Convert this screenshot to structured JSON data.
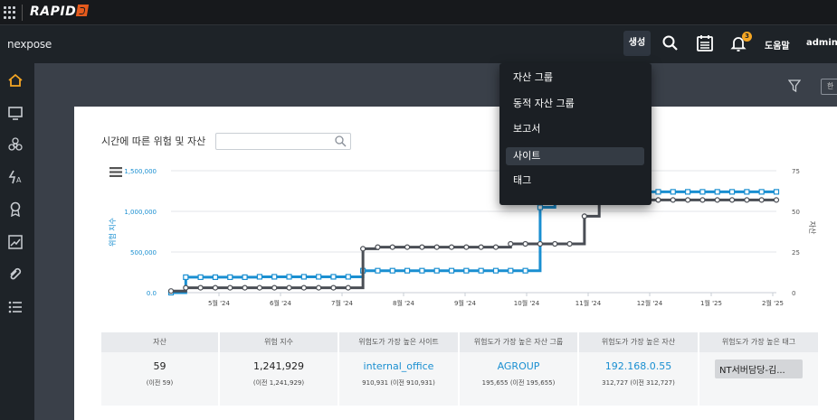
{
  "topbar": {
    "brand": "RAPID"
  },
  "header": {
    "product": "nexpose",
    "create_label": "생성",
    "notification_count": "3",
    "help_label": "도움말",
    "user_label": "admin"
  },
  "toolbar": {
    "box_label": "한"
  },
  "card": {
    "title": "시간에 따른 위험 및 자산",
    "search_placeholder": ""
  },
  "chart_data": {
    "type": "line",
    "x": [
      "5월 '24",
      "6월 '24",
      "7월 '24",
      "8월 '24",
      "9월 '24",
      "10월 '24",
      "11월 '24",
      "12월 '24",
      "1월 '25",
      "2월 '25"
    ],
    "ylabel": "위험 지수",
    "y2label": "자산",
    "y_ticks": [
      "0.0",
      "500,000",
      "1,000,000",
      "1,500,000"
    ],
    "y2_ticks": [
      "0",
      "25",
      "50",
      "75"
    ],
    "ylim": [
      0,
      1500000
    ],
    "y2lim": [
      0,
      75
    ],
    "series": [
      {
        "color": "#1a8fd1",
        "axis": "left",
        "values": [
          0,
          190000,
          190000,
          190000,
          190000,
          190000,
          195000,
          195000,
          195000,
          195000,
          195000,
          195000,
          195000,
          270000,
          270000,
          270000,
          270000,
          270000,
          270000,
          270000,
          270000,
          270000,
          270000,
          270000,
          270000,
          1050000,
          1240000,
          1240000,
          1240000,
          1240000,
          1240000,
          1240000,
          1240000,
          1240000,
          1240000,
          1240000,
          1240000,
          1240000,
          1240000,
          1240000,
          1240000,
          1240000
        ]
      },
      {
        "color": "#4a4e55",
        "axis": "right",
        "values": [
          1,
          3,
          3,
          3,
          3,
          3,
          3,
          3,
          3,
          3,
          3,
          3,
          3,
          27,
          28,
          28,
          28,
          28,
          28,
          28,
          28,
          28,
          28,
          30,
          30,
          30,
          30,
          30,
          47,
          57,
          57,
          57,
          57,
          57,
          57,
          57,
          57,
          57,
          57,
          57,
          57,
          57
        ]
      }
    ]
  },
  "stats": {
    "headers": [
      "자산",
      "위험 지수",
      "위험도가 가장 높은 사이트",
      "위험도가 가장 높은 자산 그룹",
      "위험도가 가장 높은 자산",
      "위험도가 가장 높은 태그"
    ],
    "values": [
      "59",
      "1,241,929",
      "internal_office",
      "AGROUP",
      "192.168.0.55",
      "NT서버담당-김..."
    ],
    "subs": [
      "(이전 59)",
      "(이전 1,241,929)",
      "910,931 (이전 910,931)",
      "195,655 (이전 195,655)",
      "312,727 (이전 312,727)",
      ""
    ]
  },
  "dropdown": {
    "items": [
      "자산 그룹",
      "동적 자산 그룹",
      "보고서",
      "사이트",
      "태그"
    ]
  },
  "colors": {
    "accent": "#1a8fd1",
    "brand": "#e55a1c",
    "home": "#f5a623"
  }
}
